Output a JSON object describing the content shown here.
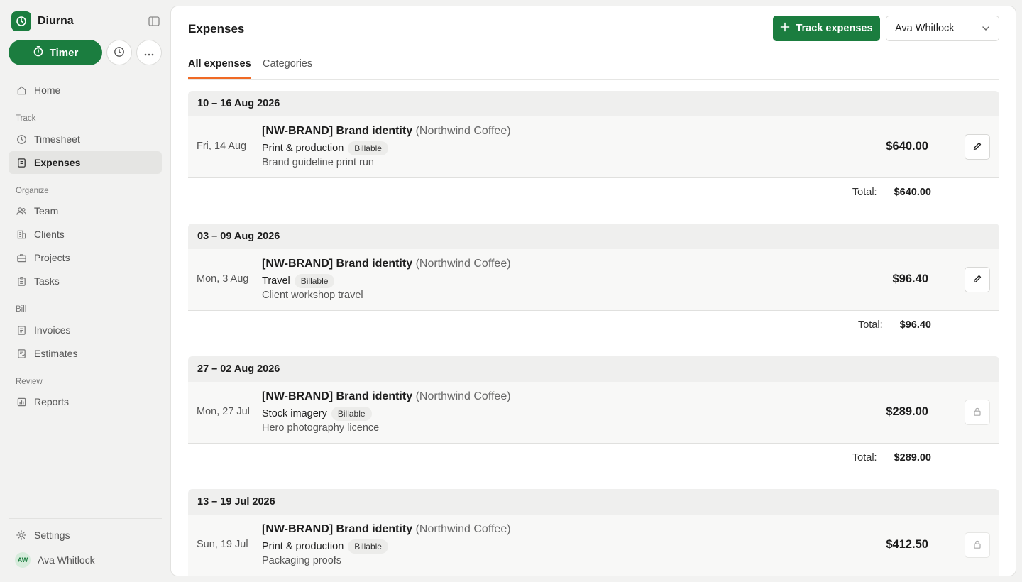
{
  "app": {
    "name": "Diurna"
  },
  "sidebar": {
    "timer_label": "Timer",
    "home_label": "Home",
    "sections": {
      "track": "Track",
      "organize": "Organize",
      "bill": "Bill",
      "review": "Review"
    },
    "items": {
      "timesheet": "Timesheet",
      "expenses": "Expenses",
      "team": "Team",
      "clients": "Clients",
      "projects": "Projects",
      "tasks": "Tasks",
      "invoices": "Invoices",
      "estimates": "Estimates",
      "reports": "Reports"
    },
    "settings_label": "Settings",
    "user": {
      "initials": "AW",
      "name": "Ava Whitlock"
    }
  },
  "header": {
    "title": "Expenses",
    "track_button": "Track expenses",
    "user_select": "Ava Whitlock"
  },
  "tabs": [
    "All expenses",
    "Categories"
  ],
  "weeks": [
    {
      "range": "10 – 16 Aug 2026",
      "entry": {
        "date": "Fri, 14 Aug",
        "project": "[NW-BRAND] Brand identity",
        "client": "(Northwind Coffee)",
        "category": "Print & production",
        "badge": "Billable",
        "notes": "Brand guideline print run",
        "amount": "$640.00",
        "locked": false
      },
      "total_label": "Total:",
      "total": "$640.00"
    },
    {
      "range": "03 – 09 Aug 2026",
      "entry": {
        "date": "Mon, 3 Aug",
        "project": "[NW-BRAND] Brand identity",
        "client": "(Northwind Coffee)",
        "category": "Travel",
        "badge": "Billable",
        "notes": "Client workshop travel",
        "amount": "$96.40",
        "locked": false
      },
      "total_label": "Total:",
      "total": "$96.40"
    },
    {
      "range": "27 – 02 Aug 2026",
      "entry": {
        "date": "Mon, 27 Jul",
        "project": "[NW-BRAND] Brand identity",
        "client": "(Northwind Coffee)",
        "category": "Stock imagery",
        "badge": "Billable",
        "notes": "Hero photography licence",
        "amount": "$289.00",
        "locked": true
      },
      "total_label": "Total:",
      "total": "$289.00"
    },
    {
      "range": "13 – 19 Jul 2026",
      "entry": {
        "date": "Sun, 19 Jul",
        "project": "[NW-BRAND] Brand identity",
        "client": "(Northwind Coffee)",
        "category": "Print & production",
        "badge": "Billable",
        "notes": "Packaging proofs",
        "amount": "$412.50",
        "locked": true
      }
    }
  ],
  "colors": {
    "brand_green": "#1b7d3f",
    "tab_accent": "#f06a25",
    "sidebar_bg": "#f2f2f1"
  }
}
